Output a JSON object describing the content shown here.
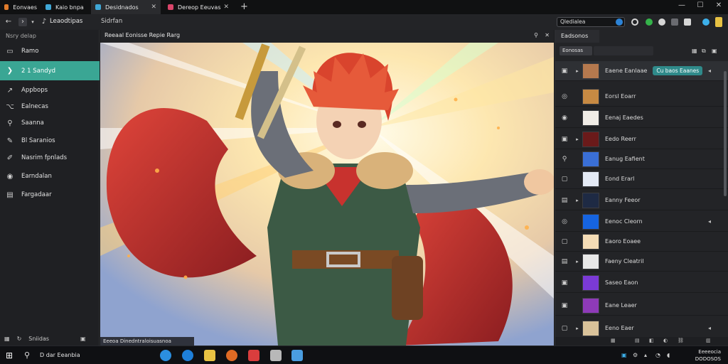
{
  "tabs": [
    {
      "label": "Eonvaes",
      "color": "#e07b2b"
    },
    {
      "label": "Kaio bnpa",
      "color": "#3fa7d6"
    },
    {
      "label": "Desidnados",
      "color": "#3fa7d6"
    },
    {
      "label": "Dereop Eeuvas",
      "color": "#d9456a"
    }
  ],
  "window_controls": {
    "minimize": "—",
    "maximize": "☐",
    "close": "✕"
  },
  "toolbar": {
    "back": "←",
    "forward": "›",
    "page_label": "Leaodtipas",
    "mode_label": "Sidrfan",
    "search_value": "Qledialea"
  },
  "sidebar": {
    "header": "Nsry delap",
    "items": [
      {
        "icon": "▭",
        "label": "Ramo"
      },
      {
        "icon": "❯",
        "label": "2 1 Sandyd"
      },
      {
        "icon": "↗",
        "label": "Appbops"
      },
      {
        "icon": "⌥",
        "label": "Ealnecas"
      },
      {
        "icon": "⚲",
        "label": "Saanna"
      },
      {
        "icon": "✎",
        "label": "Bl Saranios"
      },
      {
        "icon": "✐",
        "label": "Nasrim fpnlads"
      },
      {
        "icon": "◉",
        "label": "Earndalan"
      },
      {
        "icon": "▤",
        "label": "Fargadaar"
      }
    ],
    "footer": "Sniidas"
  },
  "document": {
    "title": "Reeaal Eonisse Repie Rarg",
    "status_text": "Eeeoa Dinedntraloisuasnoa"
  },
  "right_panel": {
    "tab": "Eadsonos",
    "filter_label": "Eonosas",
    "layers": [
      {
        "name": "Eaene Eanlaae",
        "chip": "Cu baos Eaanes",
        "swatch": "#b5794e"
      },
      {
        "name": "Eorsl Eoarr",
        "swatch": "#c78a43"
      },
      {
        "name": "Eenaj Eaedes",
        "swatch": "#f0ece6"
      },
      {
        "name": "Eedo Reerr",
        "swatch": "#6a1a1a"
      },
      {
        "name": "Eanug Eafient",
        "swatch": "#3a6fd6"
      },
      {
        "name": "Eond Erarl",
        "swatch": "#e4eaf5"
      },
      {
        "name": "Eanny Feeor",
        "swatch": "#1e2a44"
      },
      {
        "name": "Eenoc Cleorn",
        "swatch": "#1664e0"
      },
      {
        "name": "Eaoro Eoaee",
        "swatch": "#f4dcb6"
      },
      {
        "name": "Faeny Cleatril",
        "swatch": "#e8e8e8"
      },
      {
        "name": "Saseo Eaon",
        "swatch": "#7b3ad6"
      },
      {
        "name": "Eane Leaer",
        "swatch": "#8e3ab8"
      },
      {
        "name": "Eeno Eaer",
        "swatch": "#d9c29a"
      }
    ]
  },
  "taskbar": {
    "search_text": "D dar Eeanbia",
    "time": "Eeeeocia",
    "date": "DODOSOS"
  }
}
